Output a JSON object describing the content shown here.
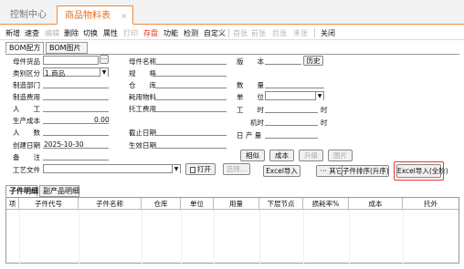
{
  "tabs": {
    "home": "控制中心",
    "active": "商品物料表",
    "close": "×"
  },
  "toolbar": [
    "新增",
    "速查",
    "编辑",
    "删除",
    "切换",
    "属性",
    "打印",
    "存盘",
    "功能",
    "检测",
    "自定义",
    "首张",
    "前张",
    "后张",
    "末张",
    "关闭"
  ],
  "subtabs": {
    "bom": "BOM配方",
    "bomimg": "BOM图片"
  },
  "form": {
    "parent_item": "母件货品",
    "category": "类别区分",
    "category_value": "1.商品",
    "mfg_dept": "制造部门",
    "mfg_cost": "制造费用",
    "labor": "人　　工",
    "prod_cost": "生产成本",
    "prod_cost_value": "0.00",
    "people": "人　　数",
    "created": "创建日期",
    "created_value": "2025-10-30",
    "remark": "备　　注",
    "process_file": "工艺文件",
    "parent_name": "母件名称",
    "spec": "规　　格",
    "warehouse": "仓　　库",
    "material": "耗用物料",
    "outsource_fee": "托工费用",
    "end_date": "截止日期",
    "effective_date": "生效日期",
    "version": "版　　本",
    "history": "历史",
    "qty": "数　　量",
    "unit": "单　　位",
    "work_time": "工　　时",
    "work_time_unit": "时",
    "machine_time": "机时",
    "machine_time_unit": "时",
    "day_output": "日 产 量"
  },
  "buttons": {
    "open": "打开",
    "select": "选择...",
    "similar": "相似",
    "cost": "成本",
    "upgrade": "升级",
    "image": "图片",
    "excel_import": "Excel导入",
    "other": "··· 其它",
    "sort": "子件排序(升序)",
    "excel_import_all": "Excel导入(全阶)",
    "dots": "···"
  },
  "grid_tabs": {
    "child": "子件明细",
    "byproduct": "副产品明细"
  },
  "columns": [
    "项",
    "子件代号",
    "子件名称",
    "仓库",
    "单位",
    "用量",
    "下层节点",
    "损耗率%",
    "成本",
    "托外"
  ]
}
